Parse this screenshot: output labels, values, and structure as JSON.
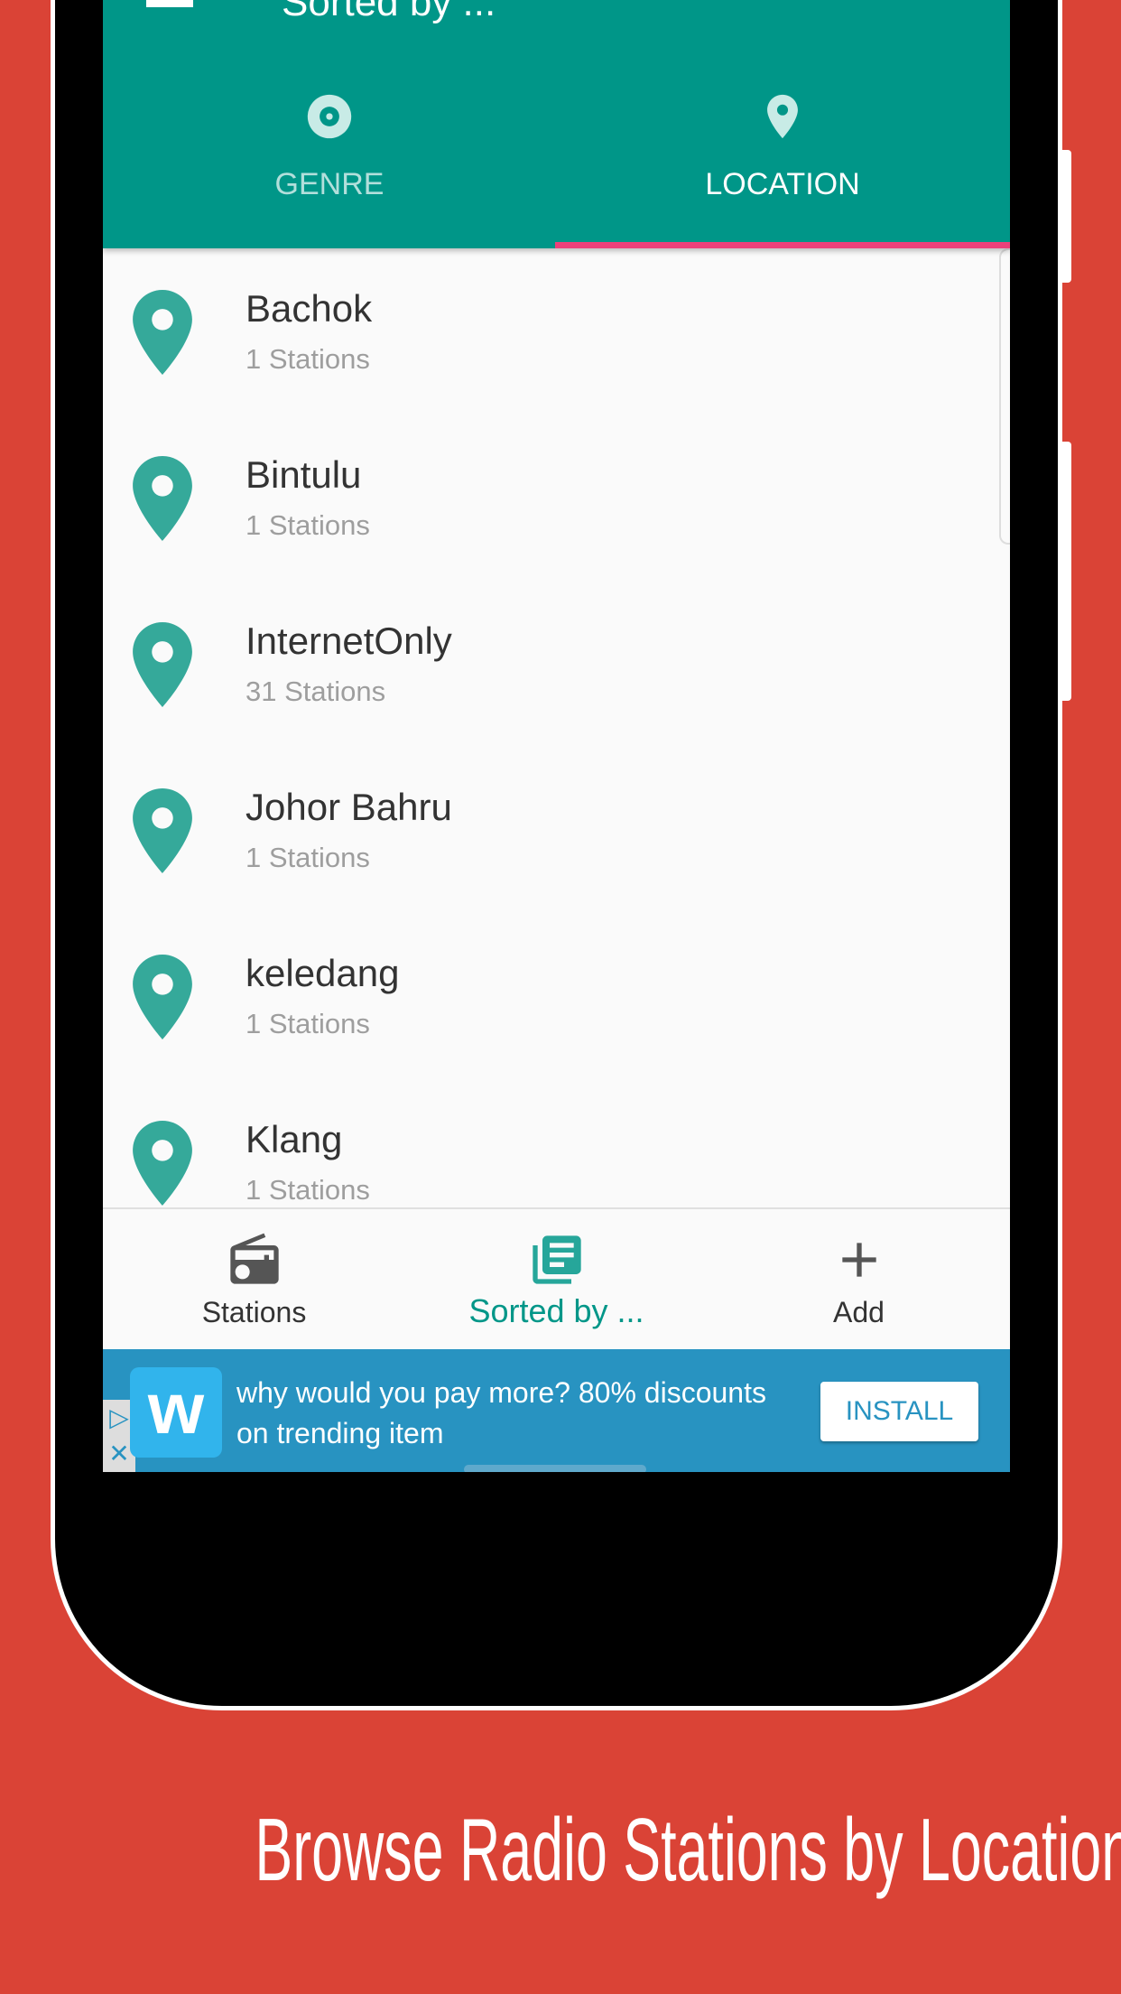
{
  "app_bar": {
    "title": "Sorted by ...",
    "menu_icon": "hamburger-icon"
  },
  "tabs": [
    {
      "label": "GENRE",
      "icon": "disc-icon",
      "selected": false
    },
    {
      "label": "LOCATION",
      "icon": "location-pin-icon",
      "selected": true
    }
  ],
  "locations": [
    {
      "name": "Bachok",
      "count": "1 Stations"
    },
    {
      "name": "Bintulu",
      "count": "1 Stations"
    },
    {
      "name": "InternetOnly",
      "count": "31 Stations"
    },
    {
      "name": "Johor Bahru",
      "count": "1 Stations"
    },
    {
      "name": "keledang",
      "count": "1 Stations"
    },
    {
      "name": "Klang",
      "count": "1 Stations"
    }
  ],
  "bottom_nav": [
    {
      "label": "Stations",
      "icon": "radio-icon"
    },
    {
      "label": "Sorted by ...",
      "icon": "library-books-icon",
      "active": true
    },
    {
      "label": "Add",
      "icon": "plus-icon"
    }
  ],
  "ad": {
    "logo": "w",
    "text_line1": "why would you pay more? 80% discounts",
    "text_line2": "on trending item",
    "button": "INSTALL"
  },
  "caption": "Browse Radio Stations by Locations",
  "colors": {
    "background": "#da4336",
    "primary": "#009688",
    "accent": "#ec407a",
    "pin": "#35a99a",
    "ad": "#2893c1"
  }
}
